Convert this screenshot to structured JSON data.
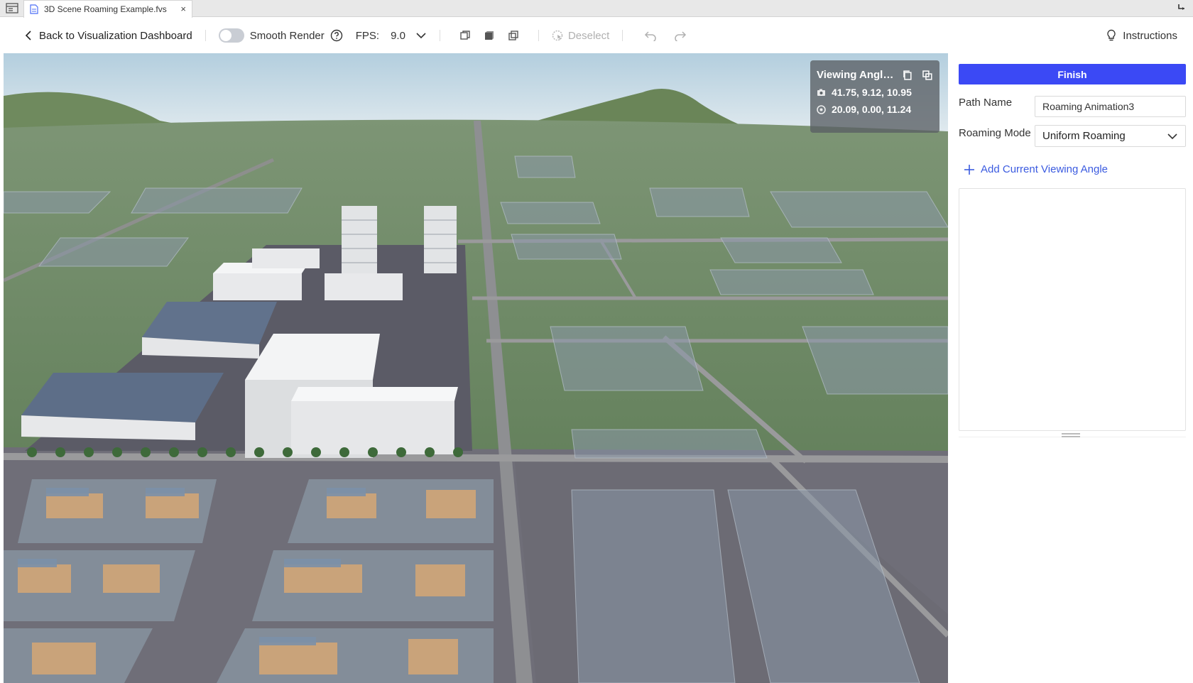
{
  "tab": {
    "title": "3D Scene Roaming Example.fvs",
    "close": "×"
  },
  "toolbar": {
    "back_label": "Back to Visualization Dashboard",
    "smooth_render_label": "Smooth Render",
    "smooth_render_on": false,
    "fps_label": "FPS:",
    "fps_value": "9.0",
    "deselect_label": "Deselect",
    "instructions_label": "Instructions"
  },
  "viewing_angle": {
    "title": "Viewing Angle...",
    "camera": "41.75, 9.12, 10.95",
    "target": "20.09, 0.00, 11.24"
  },
  "panel": {
    "finish_label": "Finish",
    "path_name_label": "Path Name",
    "path_name_value": "Roaming Animation3",
    "roaming_mode_label": "Roaming Mode",
    "roaming_mode_value": "Uniform Roaming",
    "add_angle_label": "Add Current Viewing Angle"
  },
  "colors": {
    "accent": "#3b49f5",
    "link": "#3b5be0",
    "sky": "#c9dbe6",
    "grass": "#5d7a52",
    "road": "#6f6e78"
  }
}
